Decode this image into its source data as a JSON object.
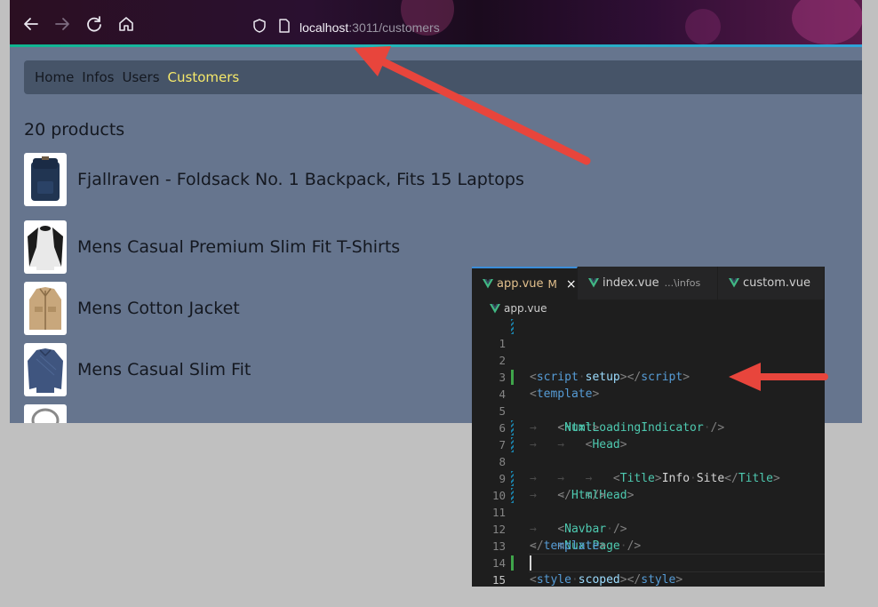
{
  "browser": {
    "url_host": "localhost",
    "url_rest": ":3011/customers",
    "nav_links": [
      "Home",
      "Infos",
      "Users",
      "Customers"
    ],
    "product_count": "20 products",
    "products": [
      "Fjallraven - Foldsack No. 1 Backpack, Fits 15 Laptops",
      "Mens Casual Premium Slim Fit T-Shirts",
      "Mens Cotton Jacket",
      "Mens Casual Slim Fit"
    ]
  },
  "editor": {
    "tabs": [
      {
        "label": "app.vue",
        "status": "M",
        "close": "×"
      },
      {
        "label": "index.vue",
        "path": "...\\infos"
      },
      {
        "label": "custom.vue"
      }
    ],
    "breadcrumb": "app.vue",
    "line_numbers": [
      "1",
      "2",
      "3",
      "4",
      "5",
      "6",
      "7",
      "8",
      "9",
      "10",
      "11",
      "12",
      "13",
      "14",
      "15"
    ]
  },
  "colors": {
    "annotation_arrow": "#e8453c",
    "active_nav": "#f5e86a",
    "page_bg": "#66758e",
    "editor_bg": "#1e1e1e"
  }
}
